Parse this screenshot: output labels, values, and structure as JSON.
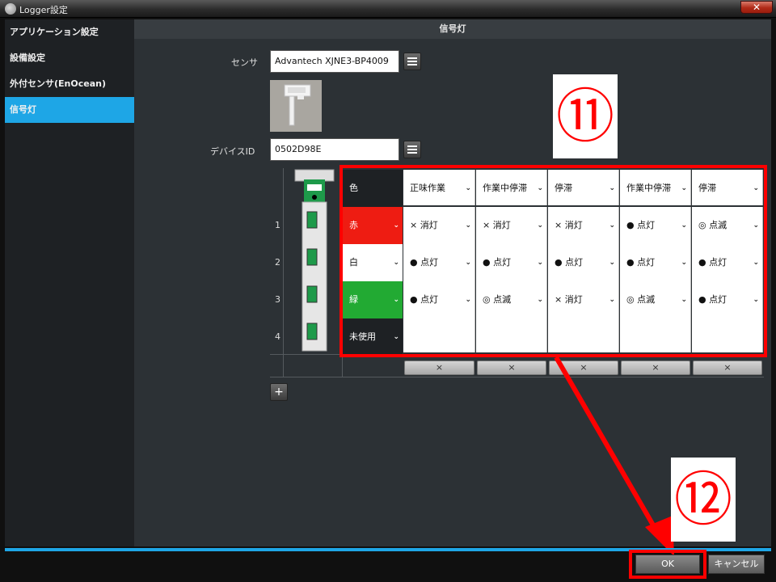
{
  "window": {
    "title": "Logger設定",
    "close_glyph": "✕"
  },
  "sidebar": {
    "items": [
      {
        "label": "アプリケーション設定",
        "active": false
      },
      {
        "label": "設備設定",
        "active": false
      },
      {
        "label": "外付センサ(EnOcean)",
        "active": false
      },
      {
        "label": "信号灯",
        "active": true
      }
    ]
  },
  "main": {
    "header": "信号灯",
    "sensor_label": "センサ",
    "sensor_value": "Advantech XJNE3-BP4009",
    "device_label": "デバイスID",
    "device_value": "0502D98E"
  },
  "table": {
    "color_header": "色",
    "columns": [
      "正味作業",
      "作業中停滞",
      "停滞",
      "作業中停滞",
      "停滞"
    ],
    "rows": [
      {
        "num": "1",
        "color": "赤",
        "color_hex": "#ee1c12",
        "values": [
          "× 消灯",
          "× 消灯",
          "× 消灯",
          "● 点灯",
          "◎ 点滅"
        ]
      },
      {
        "num": "2",
        "color": "白",
        "color_hex": "#ffffff",
        "values": [
          "● 点灯",
          "● 点灯",
          "● 点灯",
          "● 点灯",
          "● 点灯"
        ]
      },
      {
        "num": "3",
        "color": "緑",
        "color_hex": "#22aa33",
        "values": [
          "● 点灯",
          "◎ 点滅",
          "× 消灯",
          "◎ 点滅",
          "● 点灯"
        ]
      },
      {
        "num": "4",
        "color": "未使用",
        "color_hex": "#1e2124",
        "values": [
          "",
          "",
          "",
          "",
          ""
        ]
      }
    ],
    "delete_glyph": "×",
    "add_glyph": "+"
  },
  "annotations": {
    "step11": "⑪",
    "step12": "⑫"
  },
  "footer": {
    "ok": "OK",
    "cancel": "キャンセル"
  },
  "colors": {
    "accent": "#1ea6e6",
    "annotation": "#ff0000"
  }
}
